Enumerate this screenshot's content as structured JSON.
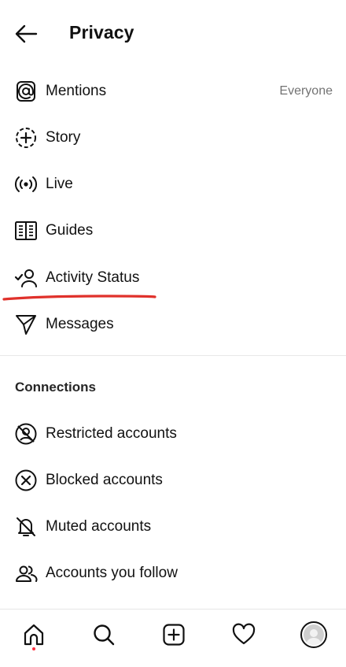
{
  "header": {
    "title": "Privacy",
    "back_icon": "arrow-left-icon"
  },
  "main_items": [
    {
      "label": "Mentions",
      "icon": "at-sign-icon",
      "value": "Everyone"
    },
    {
      "label": "Story",
      "icon": "story-add-icon"
    },
    {
      "label": "Live",
      "icon": "live-broadcast-icon"
    },
    {
      "label": "Guides",
      "icon": "guides-book-icon"
    },
    {
      "label": "Activity Status",
      "icon": "activity-status-icon"
    },
    {
      "label": "Messages",
      "icon": "messages-send-icon"
    }
  ],
  "connections": {
    "title": "Connections",
    "items": [
      {
        "label": "Restricted accounts",
        "icon": "restricted-icon"
      },
      {
        "label": "Blocked accounts",
        "icon": "blocked-icon"
      },
      {
        "label": "Muted accounts",
        "icon": "muted-bell-icon"
      },
      {
        "label": "Accounts you follow",
        "icon": "people-follow-icon"
      }
    ]
  },
  "bottom_nav": [
    {
      "name": "home",
      "icon": "home-icon"
    },
    {
      "name": "search",
      "icon": "search-icon"
    },
    {
      "name": "create",
      "icon": "plus-square-icon"
    },
    {
      "name": "activity",
      "icon": "heart-icon"
    },
    {
      "name": "profile",
      "icon": "avatar-icon"
    }
  ],
  "colors": {
    "annotation": "#e0312b",
    "notification_dot": "#ff3040",
    "secondary_text": "#737373"
  }
}
